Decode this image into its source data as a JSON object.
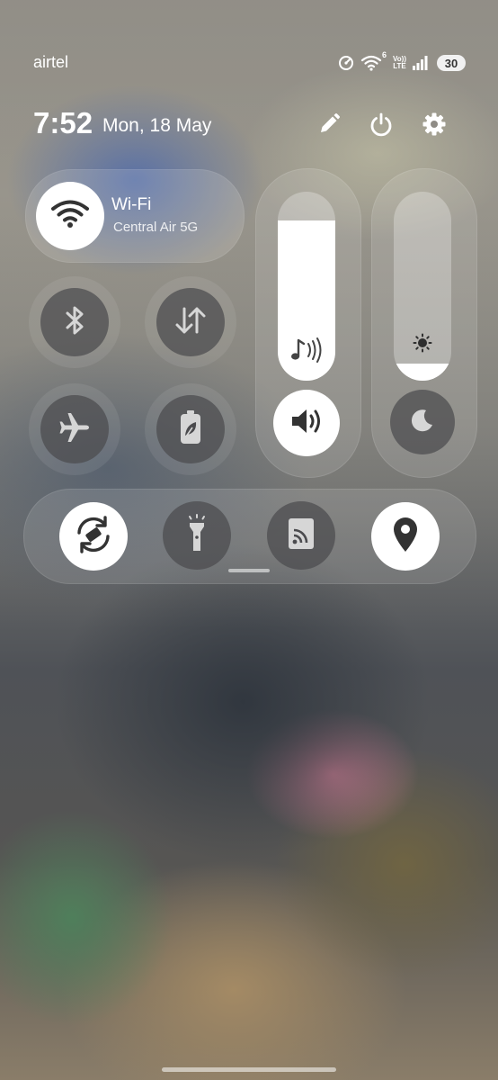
{
  "status_bar": {
    "carrier": "airtel",
    "wifi_generation": "6",
    "volte_top": "Vo))",
    "volte_bottom": "LTE",
    "battery": "30",
    "icons": [
      "data-saver-icon",
      "wifi-icon",
      "volte-icon",
      "signal-icon",
      "battery-icon"
    ]
  },
  "header": {
    "time": "7:52",
    "date": "Mon, 18 May",
    "icons": [
      "edit-icon",
      "power-icon",
      "settings-icon"
    ]
  },
  "tiles": {
    "wifi": {
      "label": "Wi-Fi",
      "network": "Central Air 5G",
      "state": "on",
      "icon": "wifi-icon"
    },
    "bluetooth": {
      "icon": "bluetooth-icon",
      "state": "off"
    },
    "mobile_data": {
      "icon": "mobile-data-icon",
      "state": "off"
    },
    "airplane": {
      "icon": "airplane-icon",
      "state": "off"
    },
    "battery_saver": {
      "icon": "battery-saver-icon",
      "state": "off"
    }
  },
  "sliders": {
    "media_volume": {
      "icon": "music-volume-icon",
      "level": 0.85
    },
    "brightness": {
      "icon": "brightness-icon",
      "level": 0.09
    }
  },
  "controls": {
    "sound": {
      "icon": "speaker-icon",
      "state": "on"
    },
    "dark_mode": {
      "icon": "moon-icon",
      "state": "off"
    }
  },
  "toolbar": {
    "auto_rotate": {
      "icon": "auto-rotate-icon",
      "state": "on"
    },
    "flashlight": {
      "icon": "flashlight-icon",
      "state": "off"
    },
    "cast": {
      "icon": "cast-icon",
      "state": "off"
    },
    "location": {
      "icon": "location-icon",
      "state": "on"
    }
  },
  "colors": {
    "active": "#ffffff",
    "inactive": "#4b4b4e",
    "icon_dark": "#333333",
    "icon_light": "#d6d6d6"
  }
}
